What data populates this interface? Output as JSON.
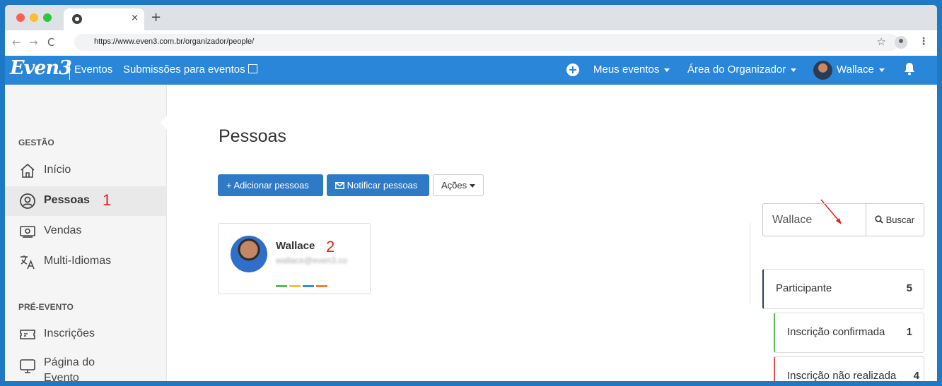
{
  "browser": {
    "url": "https://www.even3.com.br/organizador/people/",
    "tab_close": "×",
    "new_tab": "+"
  },
  "navbar": {
    "logo": "Even3",
    "links": [
      "Eventos",
      "Submissões para eventos"
    ],
    "meus_eventos": "Meus eventos",
    "area_organizador": "Área do Organizador",
    "user": "Wallace"
  },
  "sidebar": {
    "gestao_title": "GESTÃO",
    "gestao_items": [
      {
        "label": "Início",
        "icon": "home-icon"
      },
      {
        "label": "Pessoas",
        "icon": "user-circle-icon"
      },
      {
        "label": "Vendas",
        "icon": "money-icon"
      },
      {
        "label": "Multi-Idiomas",
        "icon": "translate-icon"
      }
    ],
    "pre_evento_title": "PRÉ-EVENTO",
    "pre_items": [
      {
        "label": "Inscrições",
        "icon": "ticket-icon"
      },
      {
        "label": "Página do Evento",
        "icon": "monitor-icon"
      }
    ]
  },
  "annotations": {
    "one": "1",
    "two": "2"
  },
  "main": {
    "title": "Pessoas",
    "add_button": "+ Adicionar pessoas",
    "notify_button": "Notificar pessoas",
    "actions_button": "Ações",
    "person": {
      "name": "Wallace",
      "email": "wallace@even3.co"
    }
  },
  "search": {
    "value": "Wallace",
    "button": "Buscar"
  },
  "filters": [
    {
      "label": "Participante",
      "count": "5"
    },
    {
      "label": "Inscrição confirmada",
      "count": "1"
    },
    {
      "label": "Inscrição não realizada",
      "count": "4"
    }
  ],
  "colors": {
    "accent": "#2a86d9",
    "primary_button": "#2e7ac6",
    "annotation": "#e02020"
  }
}
